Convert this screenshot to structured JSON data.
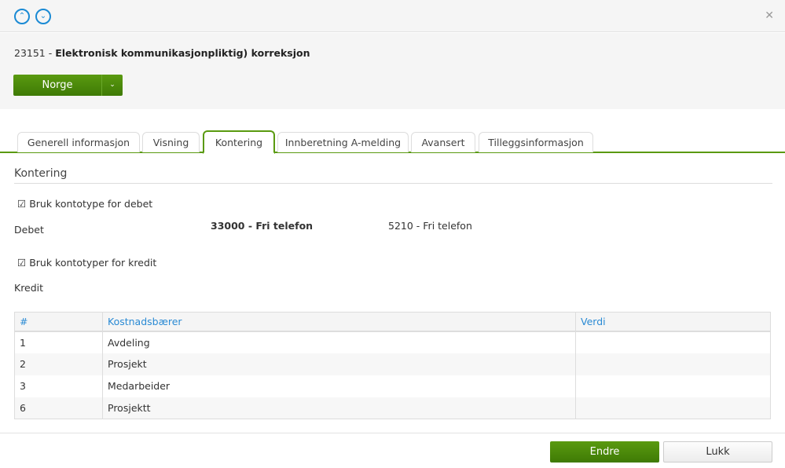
{
  "header": {
    "id": "23151",
    "separator": " - ",
    "name": "Elektronisk kommunikasjonpliktig) korreksjon"
  },
  "country_button": {
    "label": "Norge"
  },
  "tabs": [
    "Generell informasjon",
    "Visning",
    "Kontering",
    "Innberetning A-melding",
    "Avansert",
    "Tilleggsinformasjon"
  ],
  "active_tab": "Kontering",
  "section": {
    "title": "Kontering",
    "debet_check": "Bruk kontotype for debet",
    "debet_label": "Debet",
    "debet_account": "33000 - Fri telefon",
    "debet_value": "5210 - Fri telefon",
    "kredit_check": "Bruk kontotyper for kredit",
    "kredit_label": "Kredit"
  },
  "table": {
    "headers": [
      "#",
      "Kostnadsbærer",
      "Verdi"
    ],
    "rows": [
      [
        "1",
        "Avdeling",
        ""
      ],
      [
        "2",
        "Prosjekt",
        ""
      ],
      [
        "3",
        "Medarbeider",
        ""
      ],
      [
        "6",
        "Prosjektt",
        ""
      ]
    ]
  },
  "footer": {
    "edit": "Endre",
    "close": "Lukk"
  }
}
